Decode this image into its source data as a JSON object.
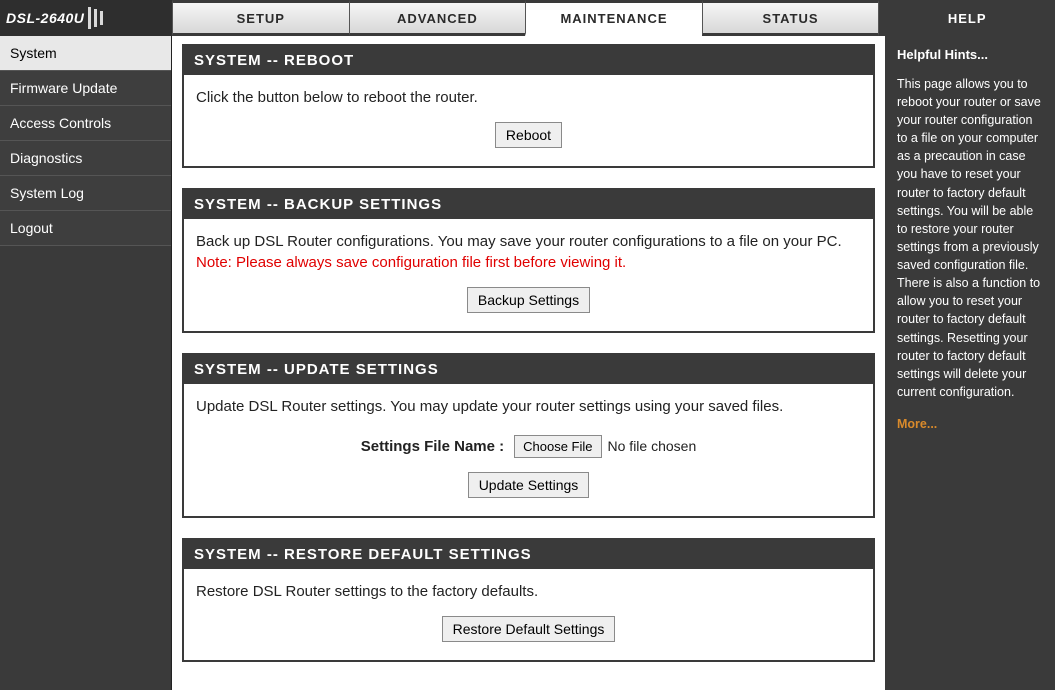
{
  "logo": {
    "model": "DSL-2640U"
  },
  "tabs": [
    {
      "label": "SETUP"
    },
    {
      "label": "ADVANCED"
    },
    {
      "label": "MAINTENANCE"
    },
    {
      "label": "STATUS"
    },
    {
      "label": "HELP"
    }
  ],
  "sidebar": {
    "items": [
      {
        "label": "System"
      },
      {
        "label": "Firmware Update"
      },
      {
        "label": "Access Controls"
      },
      {
        "label": "Diagnostics"
      },
      {
        "label": "System Log"
      },
      {
        "label": "Logout"
      }
    ]
  },
  "panels": {
    "reboot": {
      "title": "SYSTEM -- REBOOT",
      "desc": "Click the button below to reboot the router.",
      "button": "Reboot"
    },
    "backup": {
      "title": "SYSTEM -- BACKUP SETTINGS",
      "desc": "Back up DSL Router configurations. You may save your router configurations to a file on your PC.",
      "note": "Note: Please always save configuration file first before viewing it.",
      "button": "Backup Settings"
    },
    "update": {
      "title": "SYSTEM -- UPDATE SETTINGS",
      "desc": "Update DSL Router settings. You may update your router settings using your saved files.",
      "file_label": "Settings File Name :",
      "choose_button": "Choose File",
      "file_status": "No file chosen",
      "button": "Update Settings"
    },
    "restore": {
      "title": "SYSTEM -- RESTORE DEFAULT SETTINGS",
      "desc": "Restore DSL Router settings to the factory defaults.",
      "button": "Restore Default Settings"
    }
  },
  "help": {
    "title": "Helpful Hints...",
    "text": "This page allows you to reboot your router or save your router configuration to a file on your computer as a precaution in case you have to reset your router to factory default settings. You will be able to restore your router settings from a previously saved configuration file. There is also a function to allow you to reset your router to factory default settings. Resetting your router to factory default settings will delete your current configuration.",
    "more": "More..."
  }
}
